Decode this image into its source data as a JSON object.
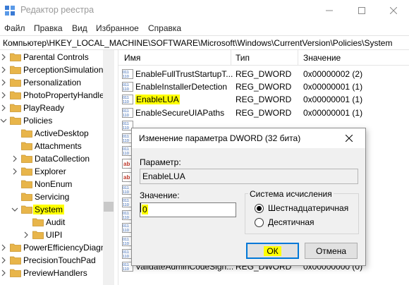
{
  "window": {
    "title": "Редактор реестра",
    "controls": {
      "minimize": "—",
      "maximize": "☐",
      "close": "✕"
    }
  },
  "menu": [
    "Файл",
    "Правка",
    "Вид",
    "Избранное",
    "Справка"
  ],
  "address": "Компьютер\\HKEY_LOCAL_MACHINE\\SOFTWARE\\Microsoft\\Windows\\CurrentVersion\\Policies\\System",
  "tree": {
    "items": [
      {
        "label": "Parental Controls",
        "level": 1,
        "expander": "collapsed",
        "selected": false
      },
      {
        "label": "PerceptionSimulation",
        "level": 1,
        "expander": "collapsed",
        "selected": false
      },
      {
        "label": "Personalization",
        "level": 1,
        "expander": "collapsed",
        "selected": false
      },
      {
        "label": "PhotoPropertyHandle",
        "level": 1,
        "expander": "collapsed",
        "selected": false
      },
      {
        "label": "PlayReady",
        "level": 1,
        "expander": "collapsed",
        "selected": false
      },
      {
        "label": "Policies",
        "level": 1,
        "expander": "expanded",
        "selected": false
      },
      {
        "label": "ActiveDesktop",
        "level": 2,
        "expander": "none",
        "selected": false
      },
      {
        "label": "Attachments",
        "level": 2,
        "expander": "none",
        "selected": false
      },
      {
        "label": "DataCollection",
        "level": 2,
        "expander": "collapsed",
        "selected": false
      },
      {
        "label": "Explorer",
        "level": 2,
        "expander": "collapsed",
        "selected": false
      },
      {
        "label": "NonEnum",
        "level": 2,
        "expander": "none",
        "selected": false
      },
      {
        "label": "Servicing",
        "level": 2,
        "expander": "none",
        "selected": false
      },
      {
        "label": "System",
        "level": 2,
        "expander": "expanded",
        "selected": true
      },
      {
        "label": "Audit",
        "level": 3,
        "expander": "none",
        "selected": false
      },
      {
        "label": "UIPI",
        "level": 3,
        "expander": "collapsed",
        "selected": false
      },
      {
        "label": "PowerEfficiencyDiagn",
        "level": 1,
        "expander": "collapsed",
        "selected": false
      },
      {
        "label": "PrecisionTouchPad",
        "level": 1,
        "expander": "collapsed",
        "selected": false
      },
      {
        "label": "PreviewHandlers",
        "level": 1,
        "expander": "collapsed",
        "selected": false
      }
    ]
  },
  "list": {
    "columns": {
      "name": "Имя",
      "type": "Тип",
      "value": "Значение"
    },
    "rows": [
      {
        "icon": "dword-icon",
        "name": "EnableFullTrustStartupT...",
        "type": "REG_DWORD",
        "value": "0x00000002 (2)",
        "highlighted": false
      },
      {
        "icon": "dword-icon",
        "name": "EnableInstallerDetection",
        "type": "REG_DWORD",
        "value": "0x00000001 (1)",
        "highlighted": false
      },
      {
        "icon": "dword-icon",
        "name": "EnableLUA",
        "type": "REG_DWORD",
        "value": "0x00000001 (1)",
        "highlighted": true
      },
      {
        "icon": "dword-icon",
        "name": "EnableSecureUIAPaths",
        "type": "REG_DWORD",
        "value": "0x00000001 (1)",
        "highlighted": false
      },
      {
        "icon": "dword-icon",
        "name": "",
        "type": "",
        "value": "",
        "highlighted": false
      },
      {
        "icon": "dword-icon",
        "name": "",
        "type": "",
        "value": "",
        "highlighted": false
      },
      {
        "icon": "dword-icon",
        "name": "",
        "type": "",
        "value": "",
        "highlighted": false
      },
      {
        "icon": "string-icon",
        "name": "",
        "type": "",
        "value": "",
        "highlighted": false
      },
      {
        "icon": "string-icon",
        "name": "",
        "type": "",
        "value": "",
        "highlighted": false
      },
      {
        "icon": "dword-icon",
        "name": "",
        "type": "",
        "value": "",
        "highlighted": false
      },
      {
        "icon": "dword-icon",
        "name": "",
        "type": "",
        "value": "",
        "highlighted": false
      },
      {
        "icon": "dword-icon",
        "name": "",
        "type": "",
        "value": "",
        "highlighted": false
      },
      {
        "icon": "dword-icon",
        "name": "",
        "type": "",
        "value": "",
        "highlighted": false
      },
      {
        "icon": "dword-icon",
        "name": "",
        "type": "",
        "value": "",
        "highlighted": false
      },
      {
        "icon": "dword-icon",
        "name": "",
        "type": "",
        "value": "",
        "highlighted": false
      },
      {
        "icon": "dword-icon",
        "name": "ValidateAdminCodeSign...",
        "type": "REG_DWORD",
        "value": "0x00000000 (0)",
        "highlighted": false
      }
    ]
  },
  "dialog": {
    "title": "Изменение параметра DWORD (32 бита)",
    "close": "✕",
    "param_label": "Параметр:",
    "param_name": "EnableLUA",
    "value_label": "Значение:",
    "value": "0",
    "base_label": "Система исчисления",
    "base_options": [
      {
        "label": "Шестнадцатеричная",
        "checked": true
      },
      {
        "label": "Десятичная",
        "checked": false
      }
    ],
    "ok": "ОК",
    "cancel": "Отмена"
  },
  "colors": {
    "highlight": "#ffff00",
    "folder": "#e8b54a",
    "accent": "#0078d7"
  }
}
